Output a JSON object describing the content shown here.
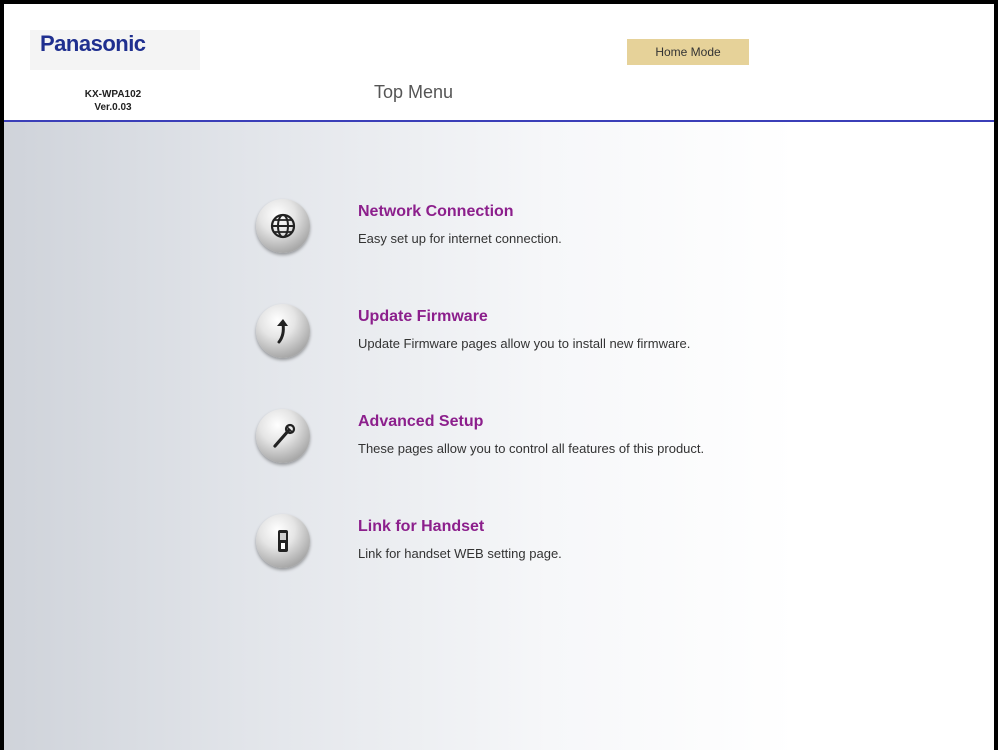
{
  "header": {
    "brand": "Panasonic",
    "model": "KX-WPA102",
    "version": "Ver.0.03",
    "mode_label": "Home Mode",
    "page_title": "Top Menu"
  },
  "colors": {
    "accent_line": "#3b3fb8",
    "link": "#8c1f8c",
    "mode_badge": "#e6d299"
  },
  "menu": {
    "items": [
      {
        "icon": "globe-icon",
        "title": "Network Connection",
        "description": "Easy set up for internet connection."
      },
      {
        "icon": "arrow-up-icon",
        "title": "Update Firmware",
        "description": "Update Firmware pages allow you to install new firmware."
      },
      {
        "icon": "wrench-icon",
        "title": "Advanced Setup",
        "description": "These pages allow you to control all features of this product."
      },
      {
        "icon": "handset-icon",
        "title": "Link for Handset",
        "description": "Link for handset WEB setting page."
      }
    ]
  }
}
